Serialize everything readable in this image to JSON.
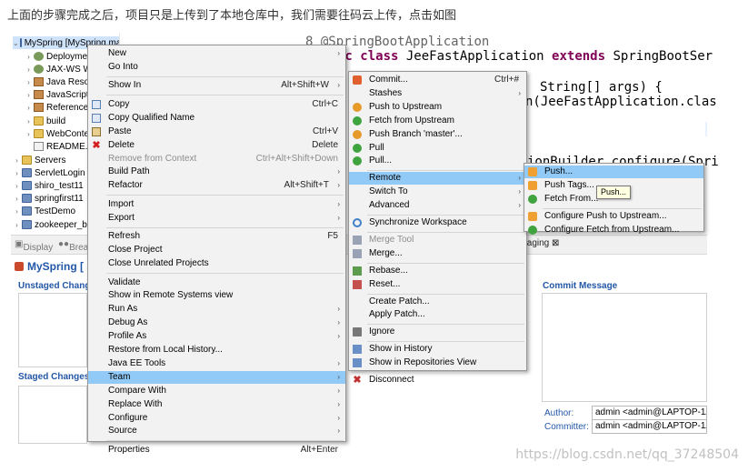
{
  "caption": "上面的步骤完成之后，项目只是上传到了本地仓库中，我们需要往码云上传，点击如图",
  "explorer": {
    "items": [
      {
        "label": "MySpring [MySpring master 12]",
        "indent": 0,
        "expand": "⌄",
        "icon": "project-icon",
        "selected": true
      },
      {
        "label": "Deployment",
        "indent": 1,
        "expand": "›",
        "icon": "gear-icon"
      },
      {
        "label": "JAX-WS W",
        "indent": 1,
        "expand": "›",
        "icon": "gear-icon"
      },
      {
        "label": "Java Reso",
        "indent": 1,
        "expand": "›",
        "icon": "jar-icon"
      },
      {
        "label": "JavaScript",
        "indent": 1,
        "expand": "›",
        "icon": "jar-icon"
      },
      {
        "label": "Reference",
        "indent": 1,
        "expand": "›",
        "icon": "jar-icon"
      },
      {
        "label": "build",
        "indent": 1,
        "expand": "›",
        "icon": "folder-icon"
      },
      {
        "label": "WebConte",
        "indent": 1,
        "expand": "›",
        "icon": "folder-icon"
      },
      {
        "label": "README.r",
        "indent": 1,
        "expand": "",
        "icon": "file-icon"
      },
      {
        "label": "Servers",
        "indent": 0,
        "expand": "›",
        "icon": "folder-icon"
      },
      {
        "label": "ServletLogin",
        "indent": 0,
        "expand": "›",
        "icon": "project-icon"
      },
      {
        "label": "shiro_test11",
        "indent": 0,
        "expand": "›",
        "icon": "project-icon"
      },
      {
        "label": "springfirst11",
        "indent": 0,
        "expand": "›",
        "icon": "project-icon"
      },
      {
        "label": "TestDemo",
        "indent": 0,
        "expand": "›",
        "icon": "project-icon"
      },
      {
        "label": "zookeeper_b",
        "indent": 0,
        "expand": "›",
        "icon": "project-icon"
      }
    ]
  },
  "editor": {
    "line_number": "8",
    "annotation": "@SpringBootApplication",
    "line2_kw1": "ic ",
    "line2_kw2": "class",
    "line2_text": " JeeFastApplication ",
    "line2_kw3": "extends",
    "line2_text2": " SpringBootSer",
    "line3": "String[] args) {",
    "line4": "n(JeeFastApplication.clas",
    "line5": "ionBuilder configure(Spri"
  },
  "views": {
    "display_tab": "Display",
    "breakpoints_tab": "Brea",
    "staging_tab": "taging ⊠"
  },
  "staging": {
    "repo_title": "MySpring [",
    "unstaged_label": "Unstaged Chang",
    "staged_label": "Staged Changes",
    "commit_message_label": "Commit Message",
    "author_label": "Author:",
    "author_value": "admin <admin@LAPTOP-1A",
    "committer_label": "Committer:",
    "committer_value": "admin <admin@LAPTOP-1A"
  },
  "context_menu": {
    "items": [
      {
        "label": "New",
        "sub": true
      },
      {
        "label": "Go Into"
      },
      {
        "sep": true
      },
      {
        "label": "Show In",
        "acc": "Alt+Shift+W",
        "sub": true
      },
      {
        "sep": true
      },
      {
        "label": "Copy",
        "acc": "Ctrl+C",
        "icon": "copy-icon"
      },
      {
        "label": "Copy Qualified Name",
        "icon": "copy-icon"
      },
      {
        "label": "Paste",
        "acc": "Ctrl+V",
        "icon": "paste-icon"
      },
      {
        "label": "Delete",
        "acc": "Delete",
        "icon": "delete-icon"
      },
      {
        "label": "Remove from Context",
        "acc": "Ctrl+Alt+Shift+Down",
        "disabled": true
      },
      {
        "label": "Build Path",
        "sub": true
      },
      {
        "label": "Refactor",
        "acc": "Alt+Shift+T",
        "sub": true
      },
      {
        "sep": true
      },
      {
        "label": "Import",
        "sub": true
      },
      {
        "label": "Export",
        "sub": true
      },
      {
        "sep": true
      },
      {
        "label": "Refresh",
        "acc": "F5"
      },
      {
        "label": "Close Project"
      },
      {
        "label": "Close Unrelated Projects"
      },
      {
        "sep": true
      },
      {
        "label": "Validate"
      },
      {
        "label": "Show in Remote Systems view"
      },
      {
        "label": "Run As",
        "sub": true
      },
      {
        "label": "Debug As",
        "sub": true
      },
      {
        "label": "Profile As",
        "sub": true
      },
      {
        "label": "Restore from Local History..."
      },
      {
        "label": "Java EE Tools",
        "sub": true
      },
      {
        "label": "Team",
        "sub": true,
        "highlight": true
      },
      {
        "label": "Compare With",
        "sub": true
      },
      {
        "label": "Replace With",
        "sub": true
      },
      {
        "label": "Configure",
        "sub": true
      },
      {
        "label": "Source",
        "sub": true
      },
      {
        "sep": true
      },
      {
        "label": "Properties",
        "acc": "Alt+Enter"
      }
    ]
  },
  "team_menu": {
    "items": [
      {
        "label": "Commit...",
        "acc": "Ctrl+#",
        "icon": "git-commit-icon"
      },
      {
        "label": "Stashes",
        "sub": true
      },
      {
        "label": "Push to Upstream",
        "icon": "push-upstream-icon"
      },
      {
        "label": "Fetch from Upstream",
        "icon": "fetch-upstream-icon"
      },
      {
        "label": "Push Branch 'master'...",
        "icon": "push-branch-icon"
      },
      {
        "label": "Pull",
        "icon": "pull-icon"
      },
      {
        "label": "Pull...",
        "icon": "pull-icon"
      },
      {
        "sep": true
      },
      {
        "label": "Remote",
        "sub": true,
        "highlight": true
      },
      {
        "label": "Switch To",
        "sub": true
      },
      {
        "label": "Advanced",
        "sub": true
      },
      {
        "sep": true
      },
      {
        "label": "Synchronize Workspace",
        "icon": "sync-icon"
      },
      {
        "sep": true
      },
      {
        "label": "Merge Tool",
        "icon": "merge-tool-icon",
        "disabled": true
      },
      {
        "label": "Merge...",
        "icon": "merge-icon"
      },
      {
        "sep": true
      },
      {
        "label": "Rebase...",
        "icon": "rebase-icon"
      },
      {
        "label": "Reset...",
        "icon": "reset-icon"
      },
      {
        "sep": true
      },
      {
        "label": "Create Patch..."
      },
      {
        "label": "Apply Patch..."
      },
      {
        "sep": true
      },
      {
        "label": "Ignore",
        "icon": "ignore-icon"
      },
      {
        "sep": true
      },
      {
        "label": "Show in History",
        "icon": "history-icon"
      },
      {
        "label": "Show in Repositories View",
        "icon": "repositories-icon"
      },
      {
        "sep": true
      },
      {
        "label": "Disconnect",
        "icon": "disconnect-icon"
      }
    ]
  },
  "remote_menu": {
    "items": [
      {
        "label": "Push...",
        "icon": "push-icon",
        "highlight": true
      },
      {
        "label": "Push Tags...",
        "icon": "push-tags-icon"
      },
      {
        "label": "Fetch From...",
        "icon": "fetch-icon"
      },
      {
        "sep": true
      },
      {
        "label": "Configure Push to Upstream...",
        "icon": "configure-push-icon"
      },
      {
        "label": "Configure Fetch from Upstream...",
        "icon": "configure-fetch-icon"
      }
    ]
  },
  "tooltip": "Push...",
  "watermark": "https://blog.csdn.net/qq_37248504",
  "colors": {
    "menu_highlight": "#91c9f7",
    "link_blue": "#2357a7",
    "keyword": "#7f0055"
  }
}
